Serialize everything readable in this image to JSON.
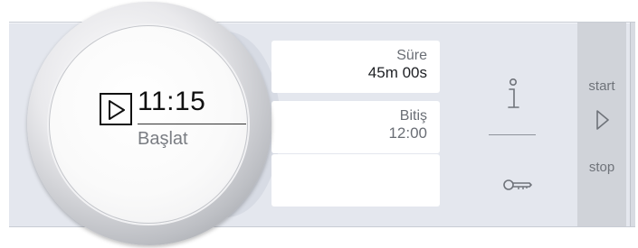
{
  "dial": {
    "time": "11:15",
    "action_label": "Başlat"
  },
  "fields": [
    {
      "label": "Süre",
      "value": "45m 00s"
    },
    {
      "label": "Bitiş",
      "value": "12:00"
    },
    {
      "label": "",
      "value": ""
    }
  ],
  "controls": {
    "start_label": "start",
    "stop_label": "stop"
  },
  "icons": {
    "play": "play-icon",
    "info": "info-icon",
    "key": "key-icon",
    "start_stop": "start-stop-icon"
  },
  "colors": {
    "panel": "#e4e7ee",
    "field": "#ffffff",
    "start_stop_bg": "#d0d3d9",
    "text_primary": "#1e2024",
    "text_secondary": "#6a6e75"
  }
}
